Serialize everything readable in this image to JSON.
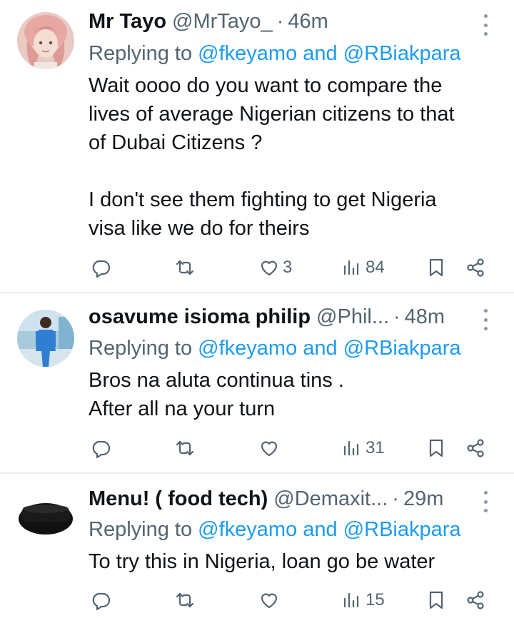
{
  "tweets": [
    {
      "name": "Mr Tayo",
      "handle": "@MrTayo_",
      "time": "46m",
      "replying_prefix": "Replying to",
      "replying_to": "@fkeyamo and @RBiakpara",
      "text_lines": [
        "Wait oooo do you want to compare the",
        "lives of average Nigerian citizens to that",
        "of Dubai Citizens ?",
        "",
        "I don't see them fighting to get Nigeria",
        "visa like we do for theirs"
      ],
      "likes": "3",
      "views": "84"
    },
    {
      "name": "osavume isioma philip",
      "handle": "@Phil...",
      "time": "48m",
      "replying_prefix": "Replying to",
      "replying_to": "@fkeyamo and @RBiakpara",
      "text_lines": [
        "Bros na aluta continua tins .",
        "After all na your turn"
      ],
      "likes": "",
      "views": "31"
    },
    {
      "name": "Menu! ( food tech)",
      "handle": "@Demaxit...",
      "time": "29m",
      "replying_prefix": "Replying to",
      "replying_to": "@fkeyamo and @RBiakpara",
      "text_lines": [
        "To try this in Nigeria, loan go be water"
      ],
      "likes": "",
      "views": "15"
    }
  ],
  "icons": {
    "reply": "reply-icon",
    "retweet": "retweet-icon",
    "like": "heart-icon",
    "views": "views-icon",
    "bookmark": "bookmark-icon",
    "share": "share-icon",
    "more": "more-icon"
  },
  "colors": {
    "link": "#1d9bf0",
    "muted": "#536471",
    "text": "#0f1419",
    "divider": "#e6ecf0"
  }
}
